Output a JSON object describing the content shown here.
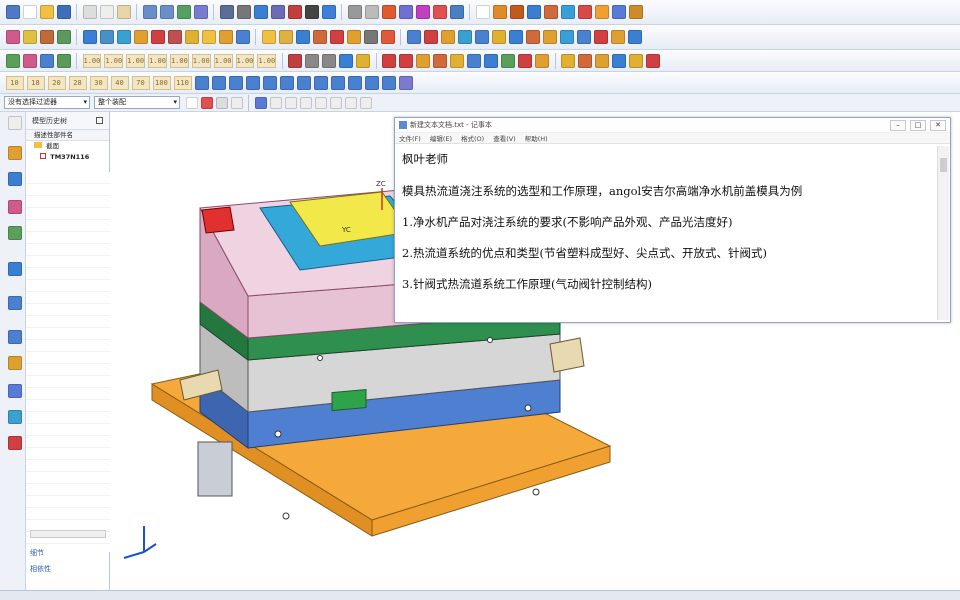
{
  "toolbar": {
    "number_buttons": [
      "10",
      "18",
      "20",
      "28",
      "30",
      "40",
      "70",
      "100",
      "110"
    ],
    "scale_labels": [
      "1.00",
      "1.00",
      "1.00",
      "1.00",
      "1.00",
      "1.00",
      "1.00",
      "1.00",
      "1.00"
    ]
  },
  "filter_bar": {
    "selection_filter": "没有选择过滤器",
    "scope": "整个装配"
  },
  "navigator": {
    "header": "模型历史树",
    "column": "描述性部件名",
    "items": [
      "截面",
      "TM37N116"
    ]
  },
  "bottom_tabs": [
    "细节",
    "相依性"
  ],
  "notepad": {
    "title": "新建文本文档.txt - 记事本",
    "menu": [
      "文件(F)",
      "编辑(E)",
      "格式(O)",
      "查看(V)",
      "帮助(H)"
    ],
    "lines": [
      "枫叶老师",
      "模具热流道浇注系统的选型和工作原理，angol安吉尔高端净水机前盖模具为例",
      "1.净水机产品对浇注系统的要求(不影响产品外观、产品光洁度好)",
      "2.热流道系统的优点和类型(节省塑料成型好、尖点式、开放式、针阀式)",
      "3.针阀式热流道系统工作原理(气动阀针控制结构)"
    ]
  },
  "axis_labels": {
    "zc": "ZC",
    "yc": "YC"
  },
  "colors": {
    "plate_orange": "#f4a93a",
    "plate_blue": "#4f7fd0",
    "plate_green": "#2f8f4f",
    "plate_grey": "#d6d6d6",
    "plate_pink": "#e7c2d4",
    "insert_yellow": "#f3e84a",
    "insert_cyan": "#34a8d9"
  }
}
